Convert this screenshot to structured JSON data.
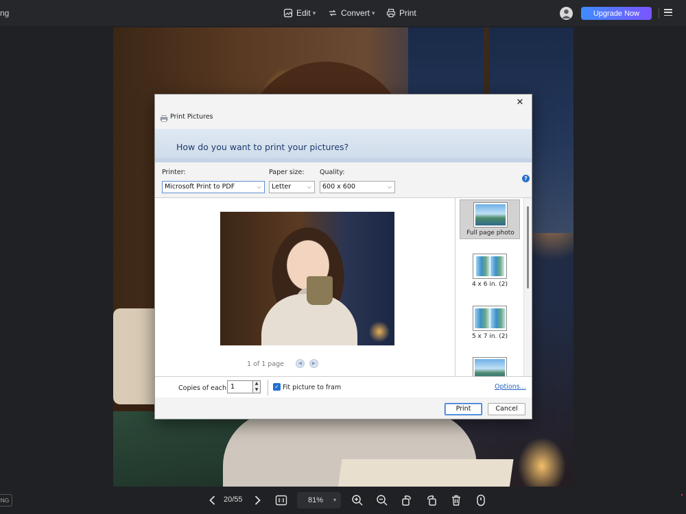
{
  "topbar": {
    "left_text": "ng",
    "menu": [
      {
        "label": "Edit",
        "icon": "image-edit-icon"
      },
      {
        "label": "Convert",
        "icon": "convert-icon"
      },
      {
        "label": "Print",
        "icon": "printer-icon"
      }
    ],
    "upgrade_label": "Upgrade Now",
    "accent_gradient": [
      "#3f8cff",
      "#7a55ff"
    ]
  },
  "dialog": {
    "title": "Print Pictures",
    "question": "How do you want to print your pictures?",
    "printer_label": "Printer:",
    "printer_value": "Microsoft Print to PDF",
    "paper_label": "Paper size:",
    "paper_value": "Letter",
    "quality_label": "Quality:",
    "quality_value": "600 x 600",
    "page_info": "1 of 1 page",
    "layouts": [
      {
        "label": "Full page photo",
        "selected": true
      },
      {
        "label": "4 x 6 in. (2)",
        "selected": false
      },
      {
        "label": "5 x 7 in. (2)",
        "selected": false
      },
      {
        "label": "",
        "selected": false
      }
    ],
    "copies_label": "Copies of each",
    "copies_value": "1",
    "fit_label": "Fit picture to fram",
    "fit_checked": true,
    "options_link": "Options...",
    "print_button": "Print",
    "cancel_button": "Cancel"
  },
  "bottombar": {
    "format_badge": "NG",
    "page_indicator": "20/55",
    "zoom": "81%"
  }
}
